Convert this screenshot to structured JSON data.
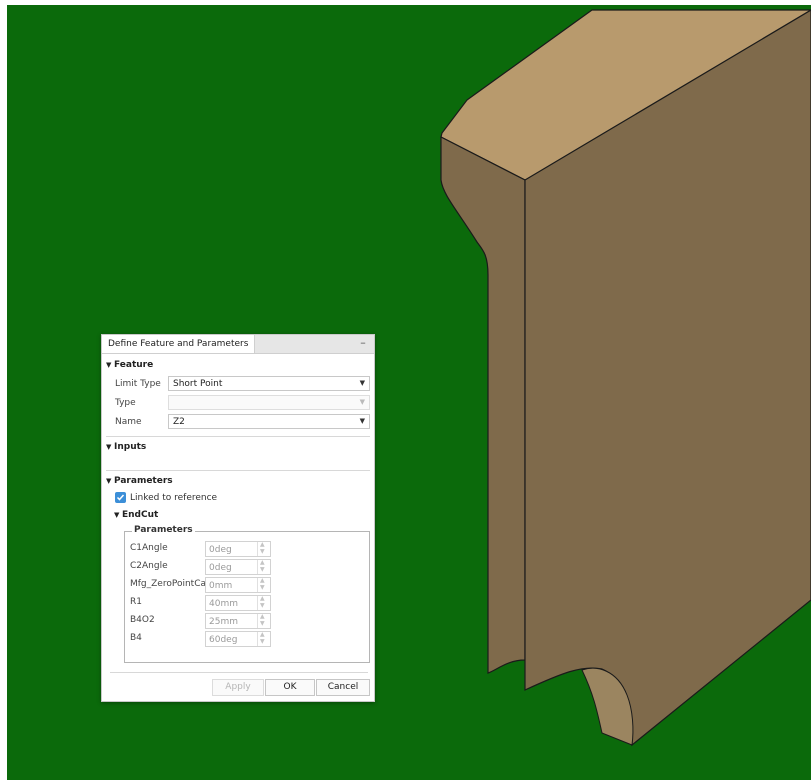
{
  "colors": {
    "background": "#0b6a0b",
    "part_top": "#b89a6d",
    "part_face": "#7f6a4b",
    "accent": "#3c8fd8"
  },
  "dialog": {
    "title": "Define Feature and Parameters",
    "minimize_icon": "minimize-icon",
    "feature": {
      "header": "Feature",
      "limit_type_label": "Limit Type",
      "limit_type_value": "Short Point",
      "type_label": "Type",
      "type_value": "",
      "name_label": "Name",
      "name_value": "Z2"
    },
    "inputs": {
      "header": "Inputs"
    },
    "parameters": {
      "header": "Parameters",
      "linked_label": "Linked to reference",
      "linked_checked": true,
      "endcut_header": "EndCut",
      "group_title": "Parameters",
      "rows": [
        {
          "label": "C1Angle",
          "value": "0deg"
        },
        {
          "label": "C2Angle",
          "value": "0deg"
        },
        {
          "label": "Mfg_ZeroPointCalc",
          "value": "0mm"
        },
        {
          "label": "R1",
          "value": "40mm"
        },
        {
          "label": "B4O2",
          "value": "25mm"
        },
        {
          "label": "B4",
          "value": "60deg"
        }
      ]
    },
    "buttons": {
      "apply": "Apply",
      "ok": "OK",
      "cancel": "Cancel"
    }
  }
}
